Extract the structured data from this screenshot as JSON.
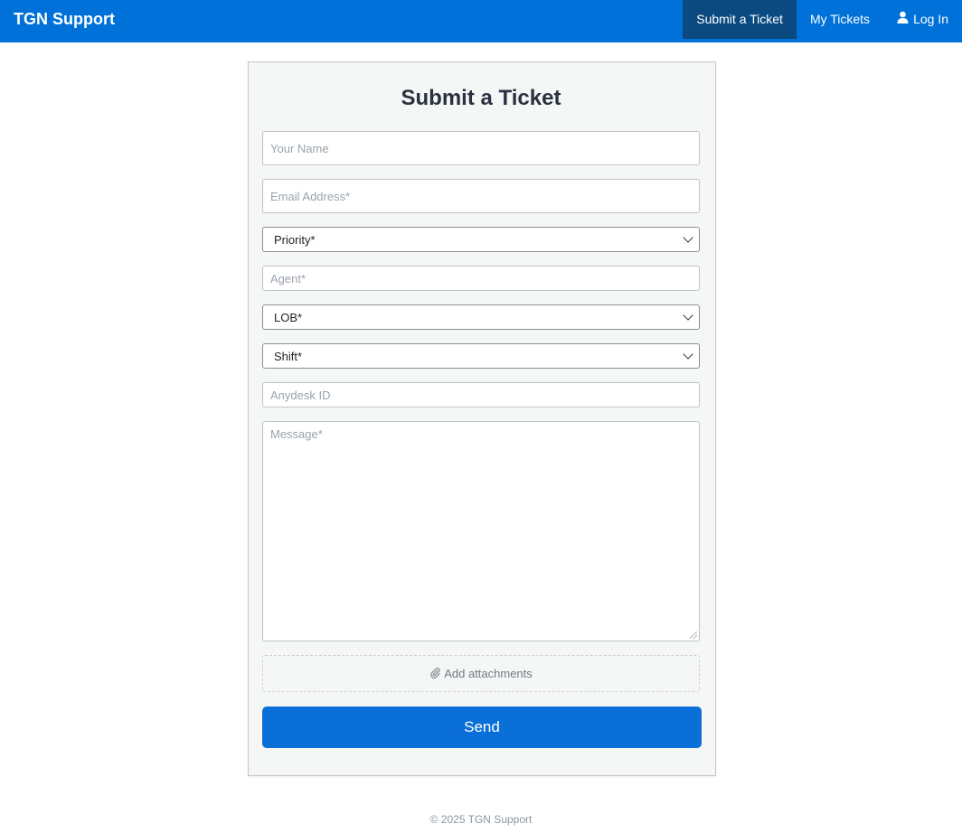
{
  "app": {
    "brand": "TGN Support"
  },
  "nav": {
    "submit_ticket": "Submit a Ticket",
    "my_tickets": "My Tickets",
    "log_in": "Log In"
  },
  "form": {
    "title": "Submit a Ticket",
    "name_placeholder": "Your Name",
    "email_placeholder": "Email Address*",
    "priority_selected": "Priority*",
    "agent_placeholder": "Agent*",
    "lob_selected": "LOB*",
    "shift_selected": "Shift*",
    "anydesk_placeholder": "Anydesk ID",
    "message_placeholder": "Message*",
    "attachments_label": "Add attachments",
    "send_label": "Send"
  },
  "footer": {
    "text": "© 2025 TGN Support"
  },
  "colors": {
    "primary": "#0071d9",
    "nav_active": "#0a4a80",
    "send_button": "#0a6fd6"
  }
}
